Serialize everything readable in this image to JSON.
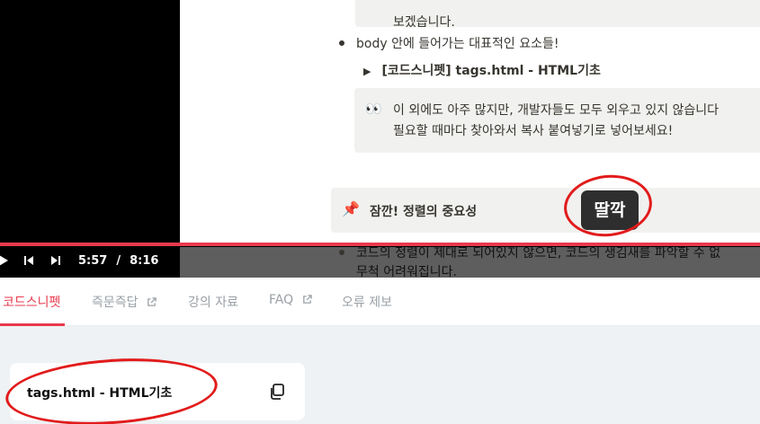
{
  "video": {
    "document": {
      "callout_top_text": "보겠습니다.",
      "bullet_1": "body 안에 들어가는 대표적인 요소들!",
      "toggle_label": "[코드스니펫] tags.html - HTML기초",
      "callout_eyes_icon": "eyes-emoji",
      "callout_line_1": "이 외에도 아주 많지만, 개발자들도 모두 외우고 있지 않습니다",
      "callout_line_2": "필요할 때마다 찾아와서 복사 붙여넣기로 넣어보세요!",
      "pin_icon": "pushpin-emoji",
      "callout_pin_text": "잠깐! 정렬의 중요성",
      "bullet_2_line_1": "코드의 정렬이 제대로 되어있지 않으면, 코드의 생김새를 파악할 수 없",
      "bullet_2_line_2": "무척 어려워집니다."
    },
    "overlay_badge": "딸깍",
    "controls": {
      "current_time": "5:57",
      "separator": "/",
      "duration": "8:16"
    },
    "progress": 0.72
  },
  "tabs": [
    {
      "label": "코드스니펫",
      "active": true,
      "external": false
    },
    {
      "label": "즉문즉답",
      "active": false,
      "external": true
    },
    {
      "label": "강의 자료",
      "active": false,
      "external": false
    },
    {
      "label": "FAQ",
      "active": false,
      "external": true
    },
    {
      "label": "오류 제보",
      "active": false,
      "external": false
    }
  ],
  "snippet_card": {
    "title": "tags.html - HTML기초",
    "copy_icon": "copy-icon"
  },
  "colors": {
    "accent": "#e8394d",
    "annotation": "#e21b1b",
    "panel_bg": "#eef2f4"
  }
}
